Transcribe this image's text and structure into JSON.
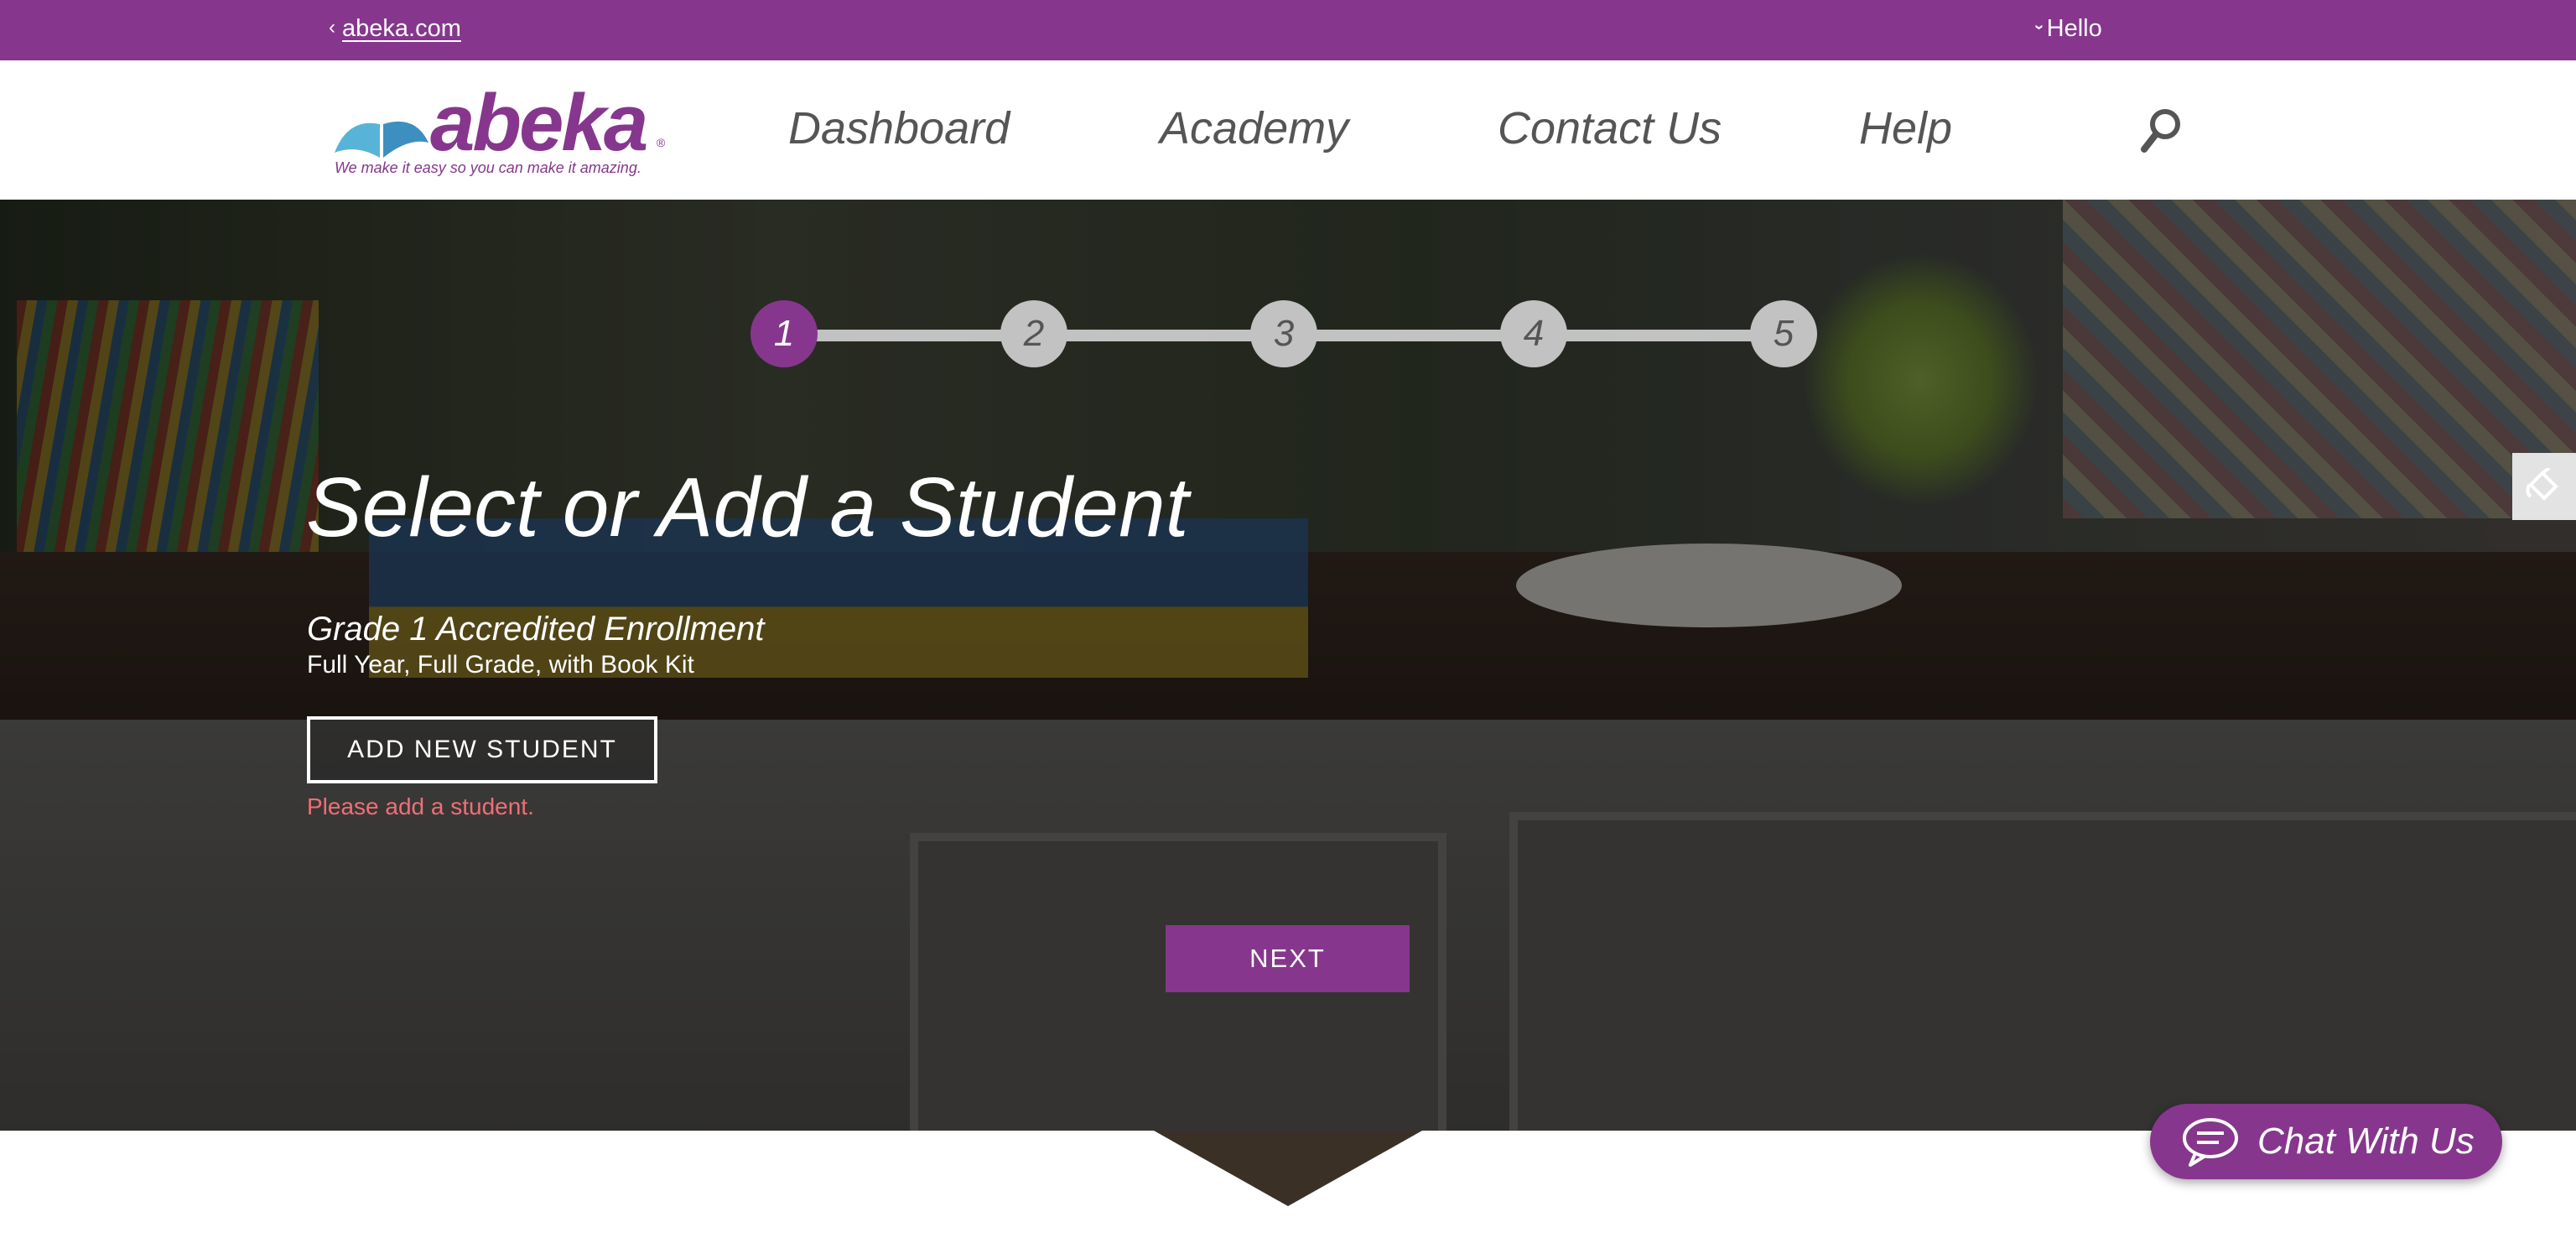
{
  "topbar": {
    "back_link": "abeka.com",
    "greeting": "Hello"
  },
  "header": {
    "logo_text": "abeka",
    "logo_reg": "®",
    "tagline": "We make it easy so you can make it amazing.",
    "nav": [
      "Dashboard",
      "Academy",
      "Contact Us",
      "Help"
    ],
    "search_icon": "search-icon"
  },
  "stepper": {
    "steps": [
      "1",
      "2",
      "3",
      "4",
      "5"
    ],
    "active_step": 1
  },
  "main": {
    "title": "Select or Add a Student",
    "course_title": "Grade 1 Accredited Enrollment",
    "course_subtitle": "Full Year, Full Grade, with Book Kit",
    "add_button": "ADD NEW STUDENT",
    "error": "Please add a student.",
    "next_button": "NEXT"
  },
  "chat": {
    "label": "Chat With Us",
    "icon": "chat-bubble-icon"
  },
  "colors": {
    "brand": "#86378d",
    "error": "#f06e78",
    "step_inactive": "#c2c2c2"
  }
}
